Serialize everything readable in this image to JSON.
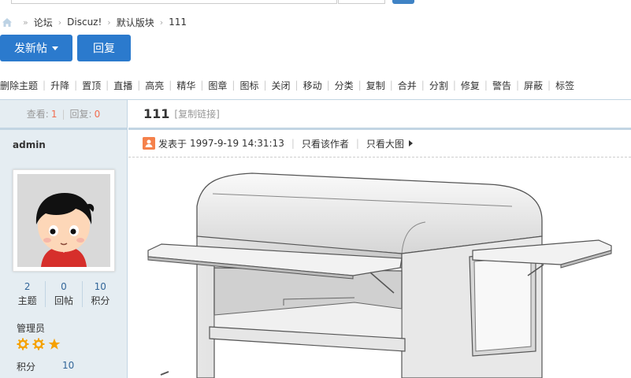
{
  "breadcrumb": {
    "home_icon": "home-icon",
    "items": [
      "论坛",
      "Discuz!",
      "默认版块",
      "111"
    ]
  },
  "actions": {
    "new_post_label": "发新帖",
    "reply_label": "回复"
  },
  "modbar": {
    "items": [
      "删除主题",
      "升降",
      "置顶",
      "直播",
      "高亮",
      "精华",
      "图章",
      "图标",
      "关闭",
      "移动",
      "分类",
      "复制",
      "合并",
      "分割",
      "修复",
      "警告",
      "屏蔽",
      "标签"
    ]
  },
  "thread": {
    "views_label": "查看:",
    "views": "1",
    "replies_label": "回复:",
    "replies": "0",
    "title": "111",
    "copy_link": "[复制链接]"
  },
  "post": {
    "meta_prefix": "发表于",
    "date": "1997-9-19 14:31:13",
    "author_only": "只看该作者",
    "view_large": "只看大图"
  },
  "author": {
    "name": "admin",
    "counts": [
      {
        "value": "2",
        "label": "主题"
      },
      {
        "value": "0",
        "label": "回帖"
      },
      {
        "value": "10",
        "label": "积分"
      }
    ],
    "group": "管理员",
    "credit_label": "积分",
    "credit_value": "10"
  },
  "colors": {
    "primary": "#2b7acd",
    "accent_red": "#f26c4f",
    "star_orange": "#f5a100",
    "sidebar_bg": "#e5edf2",
    "border": "#c2d5e3"
  }
}
